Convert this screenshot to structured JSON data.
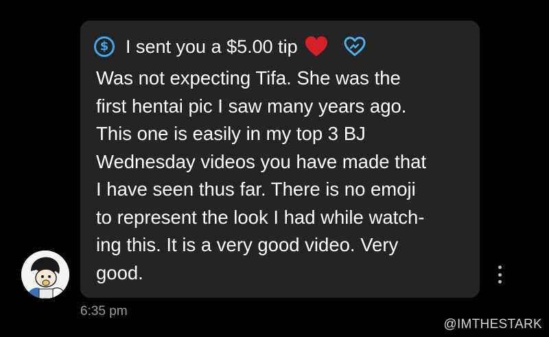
{
  "message": {
    "tip_text": "I sent you a $5.00 tip",
    "tip_icon": "dollar-circle-icon",
    "tip_accent_color": "#3fa7f0",
    "reaction_icons": [
      "red-heart-icon",
      "blue-outlined-heart-icon"
    ],
    "body_lines": [
      "Was not expecting Tifa. She was the",
      "first hentai pic I saw many years ago.",
      "This one is easily in my top 3 BJ",
      "Wednesday videos you have made that",
      "I have seen thus far. There is no emoji",
      "to represent the look I had while watch-",
      "ing this. It is a very good video. Very",
      "good."
    ],
    "timestamp": "6:35 pm",
    "bubble_color": "#222426"
  },
  "more_options_icon": "vertical-ellipsis-icon",
  "avatar_icon": "user-avatar",
  "watermark": "@IMTHESTARK"
}
